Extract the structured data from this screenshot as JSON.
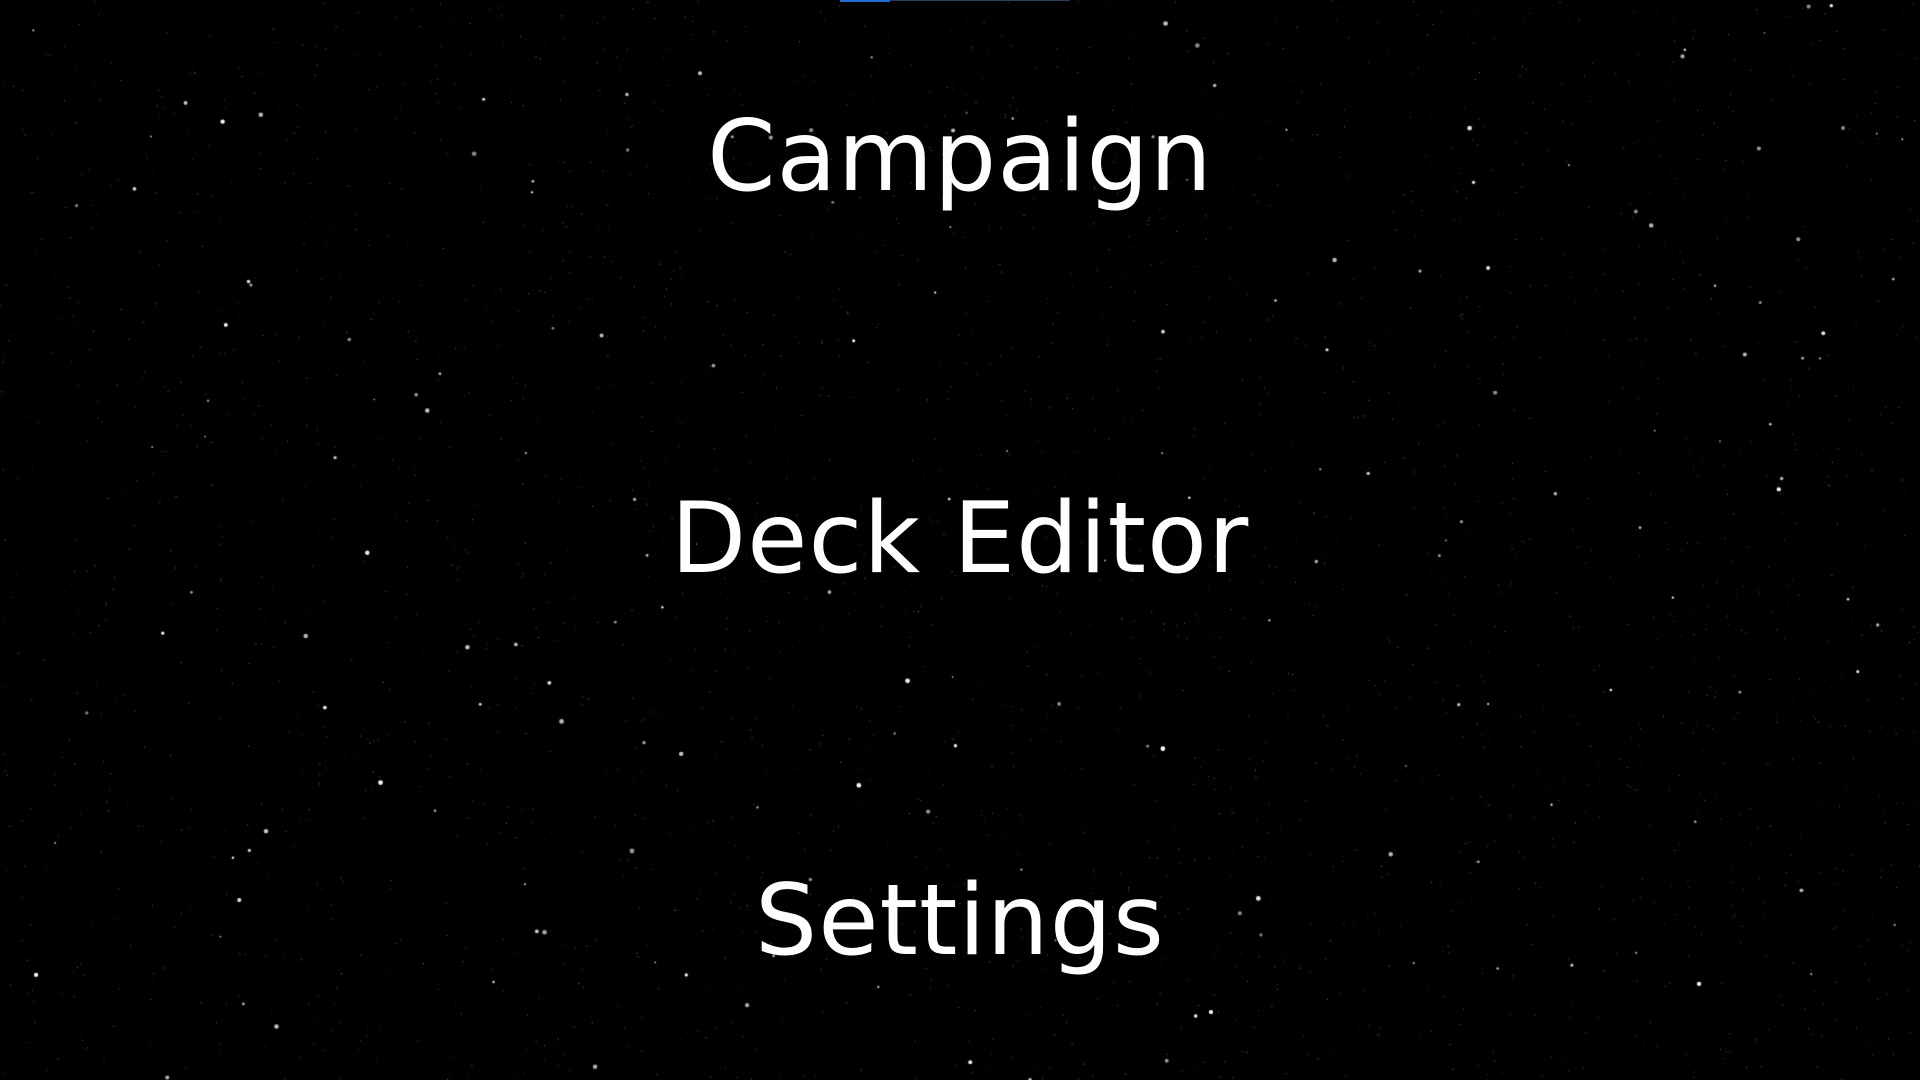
{
  "screen": {
    "background_color": "#000000",
    "accent_color": "#1e6fd6",
    "text_color": "#ffffff"
  },
  "main_menu": {
    "items": [
      {
        "label": "Campaign"
      },
      {
        "label": "Deck Editor"
      },
      {
        "label": "Settings"
      }
    ]
  }
}
